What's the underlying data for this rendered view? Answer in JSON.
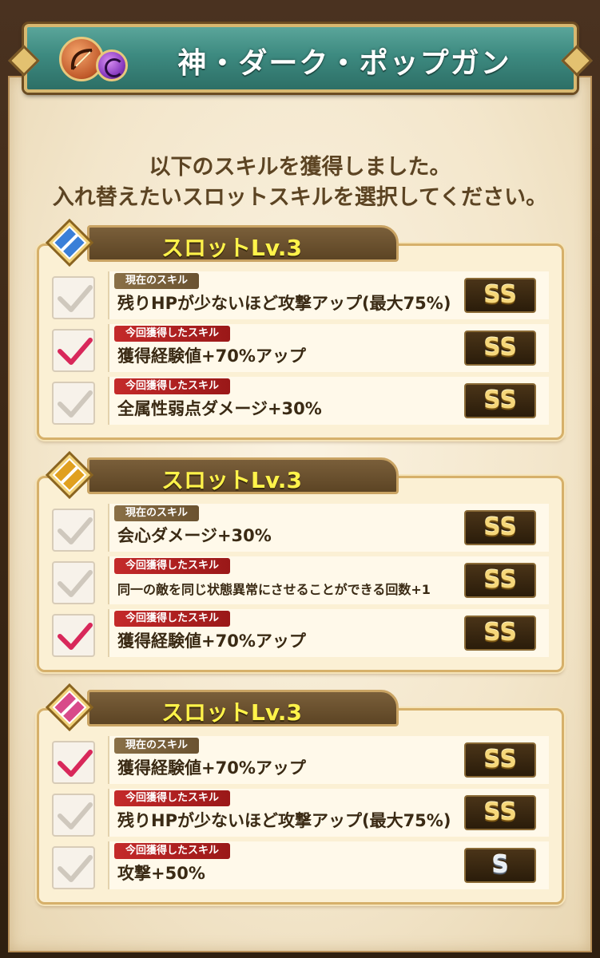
{
  "header": {
    "title": "神・ダーク・ポップガン",
    "weapon_icon": "bow-icon",
    "element_icon": "dark-orb-icon"
  },
  "intro": {
    "line1": "以下のスキルを獲得しました。",
    "line2": "入れ替えたいスロットスキルを選択してください。"
  },
  "slots": [
    {
      "label": "スロットLv.3",
      "badge_color": "#3a7fd8",
      "rows": [
        {
          "tag": "現在のスキル",
          "skill": "残りHPが少ないほど攻撃アップ(最大75%)",
          "rank": "SS",
          "selected": false
        },
        {
          "tag": "今回獲得したスキル",
          "skill": "獲得経験値+70%アップ",
          "rank": "SS",
          "selected": true
        },
        {
          "tag": "今回獲得したスキル",
          "skill": "全属性弱点ダメージ+30%",
          "rank": "SS",
          "selected": false
        }
      ]
    },
    {
      "label": "スロットLv.3",
      "badge_color": "#e0a020",
      "rows": [
        {
          "tag": "現在のスキル",
          "skill": "会心ダメージ+30%",
          "rank": "SS",
          "selected": false
        },
        {
          "tag": "今回獲得したスキル",
          "skill": "同一の敵を同じ状態異常にさせることができる回数+1",
          "rank": "SS",
          "selected": false
        },
        {
          "tag": "今回獲得したスキル",
          "skill": "獲得経験値+70%アップ",
          "rank": "SS",
          "selected": true
        }
      ]
    },
    {
      "label": "スロットLv.3",
      "badge_color": "#d84a8a",
      "rows": [
        {
          "tag": "現在のスキル",
          "skill": "獲得経験値+70%アップ",
          "rank": "SS",
          "selected": true
        },
        {
          "tag": "今回獲得したスキル",
          "skill": "残りHPが少ないほど攻撃アップ(最大75%)",
          "rank": "SS",
          "selected": false
        },
        {
          "tag": "今回獲得したスキル",
          "skill": "攻撃+50%",
          "rank": "S",
          "selected": false
        }
      ]
    }
  ]
}
